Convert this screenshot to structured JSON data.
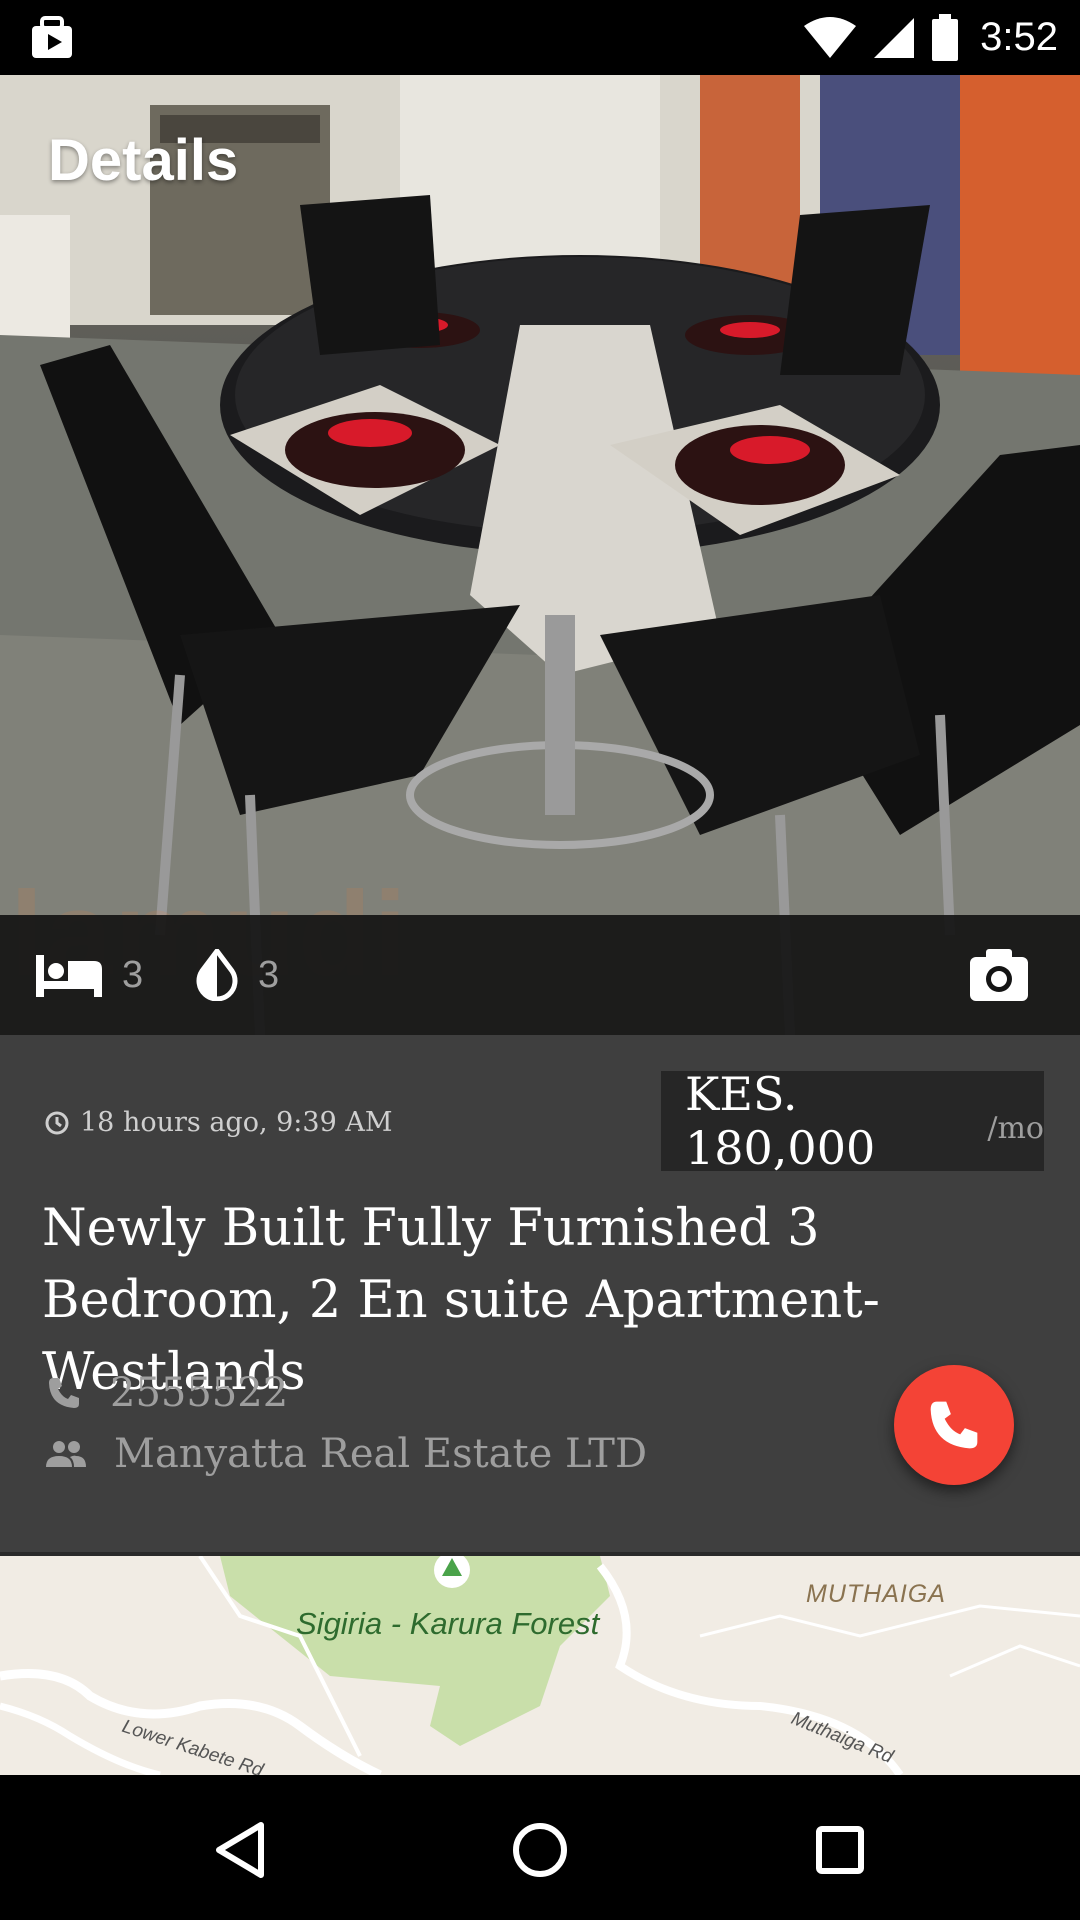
{
  "status_bar": {
    "time": "3:52",
    "icons": [
      "media-notification-icon",
      "wifi-icon",
      "cell-signal-icon",
      "battery-icon"
    ]
  },
  "header": {
    "title": "Details"
  },
  "photo": {
    "watermark_text": "lamudi"
  },
  "features": {
    "bedrooms": "3",
    "bathrooms": "3",
    "icons": [
      "bed-icon",
      "water-drop-icon",
      "camera-icon"
    ]
  },
  "listing": {
    "posted": "18 hours ago, 9:39 AM",
    "price": "KES. 180,000",
    "price_unit": "/mo",
    "title": "Newly Built Fully Furnished 3 Bedroom, 2 En suite Apartment-Westlands",
    "phone": "2555522",
    "agency": "Manyatta Real Estate LTD"
  },
  "map": {
    "forest_label": "Sigiria - Karura Forest",
    "area_label": "MUTHAIGA",
    "road_label_1": "Lower Kabete Rd",
    "road_label_2": "Muthaiga Rd"
  },
  "colors": {
    "accent_fab": "#f44336",
    "card_background": "#3f3f3f",
    "price_background": "#262626"
  }
}
